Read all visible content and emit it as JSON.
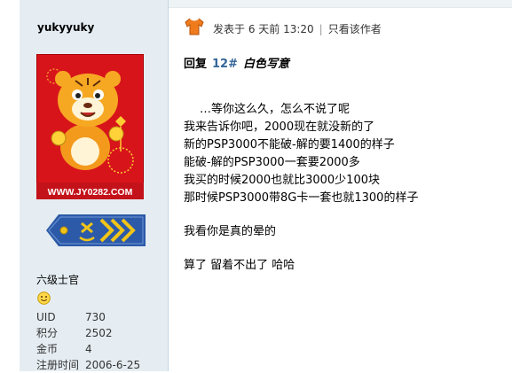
{
  "user": {
    "name": "yukyyuky",
    "avatar_caption": "WWW.JY0282.COM",
    "rank_title": "六级士官",
    "stats": [
      {
        "label": "UID",
        "value": "730"
      },
      {
        "label": "积分",
        "value": "2502"
      },
      {
        "label": "金币",
        "value": "4"
      },
      {
        "label": "注册时间",
        "value": "2006-6-25"
      }
    ]
  },
  "post": {
    "posted_label": "发表于 6 天前 13:20",
    "separator": "|",
    "only_author": "只看该作者",
    "reply_word": "回复",
    "floor": "12#",
    "reply_to": "白色写意",
    "lines_group1": [
      "…等你这么久，怎么不说了呢",
      "我来告诉你吧，2000现在就没新的了",
      "新的PSP3000不能破-解的要1400的样子",
      "能破-解的PSP3000一套要2000多",
      "我买的时候2000也就比3000少100块",
      "那时候PSP3000带8G卡一套也就1300的样子"
    ],
    "line_group2": "我看你是真的晕的",
    "line_group3": "算了 留着不出了 哈哈"
  },
  "colors": {
    "sidebar_bg": "#e5edf2",
    "floor_blue": "#336699",
    "avatar_red": "#d8141b",
    "rank_blue": "#2c5aa8",
    "rank_gold": "#f0c419"
  }
}
